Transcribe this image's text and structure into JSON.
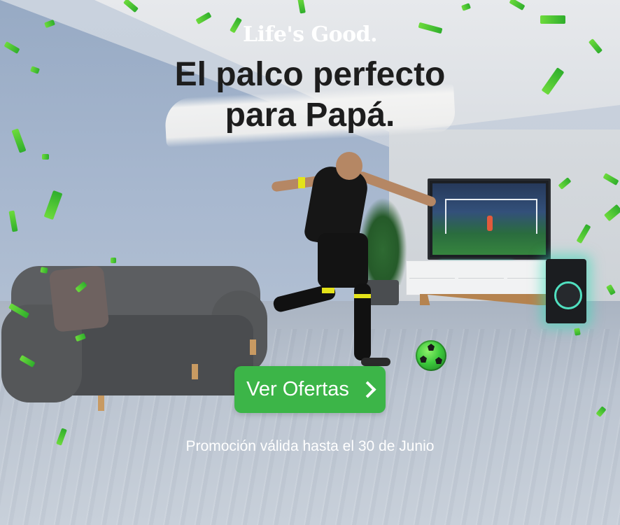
{
  "brand": {
    "logo_text": "Life's Good."
  },
  "headline": {
    "line1": "El palco perfecto",
    "line2": "para Papá."
  },
  "cta": {
    "label": "Ver Ofertas",
    "icon": "chevron-right-icon"
  },
  "disclaimer": "Promoción válida hasta el 30 de Junio",
  "colors": {
    "cta_green": "#3cb548",
    "confetti_green": "#4cc93a",
    "headline_text": "#1d1d1d"
  }
}
